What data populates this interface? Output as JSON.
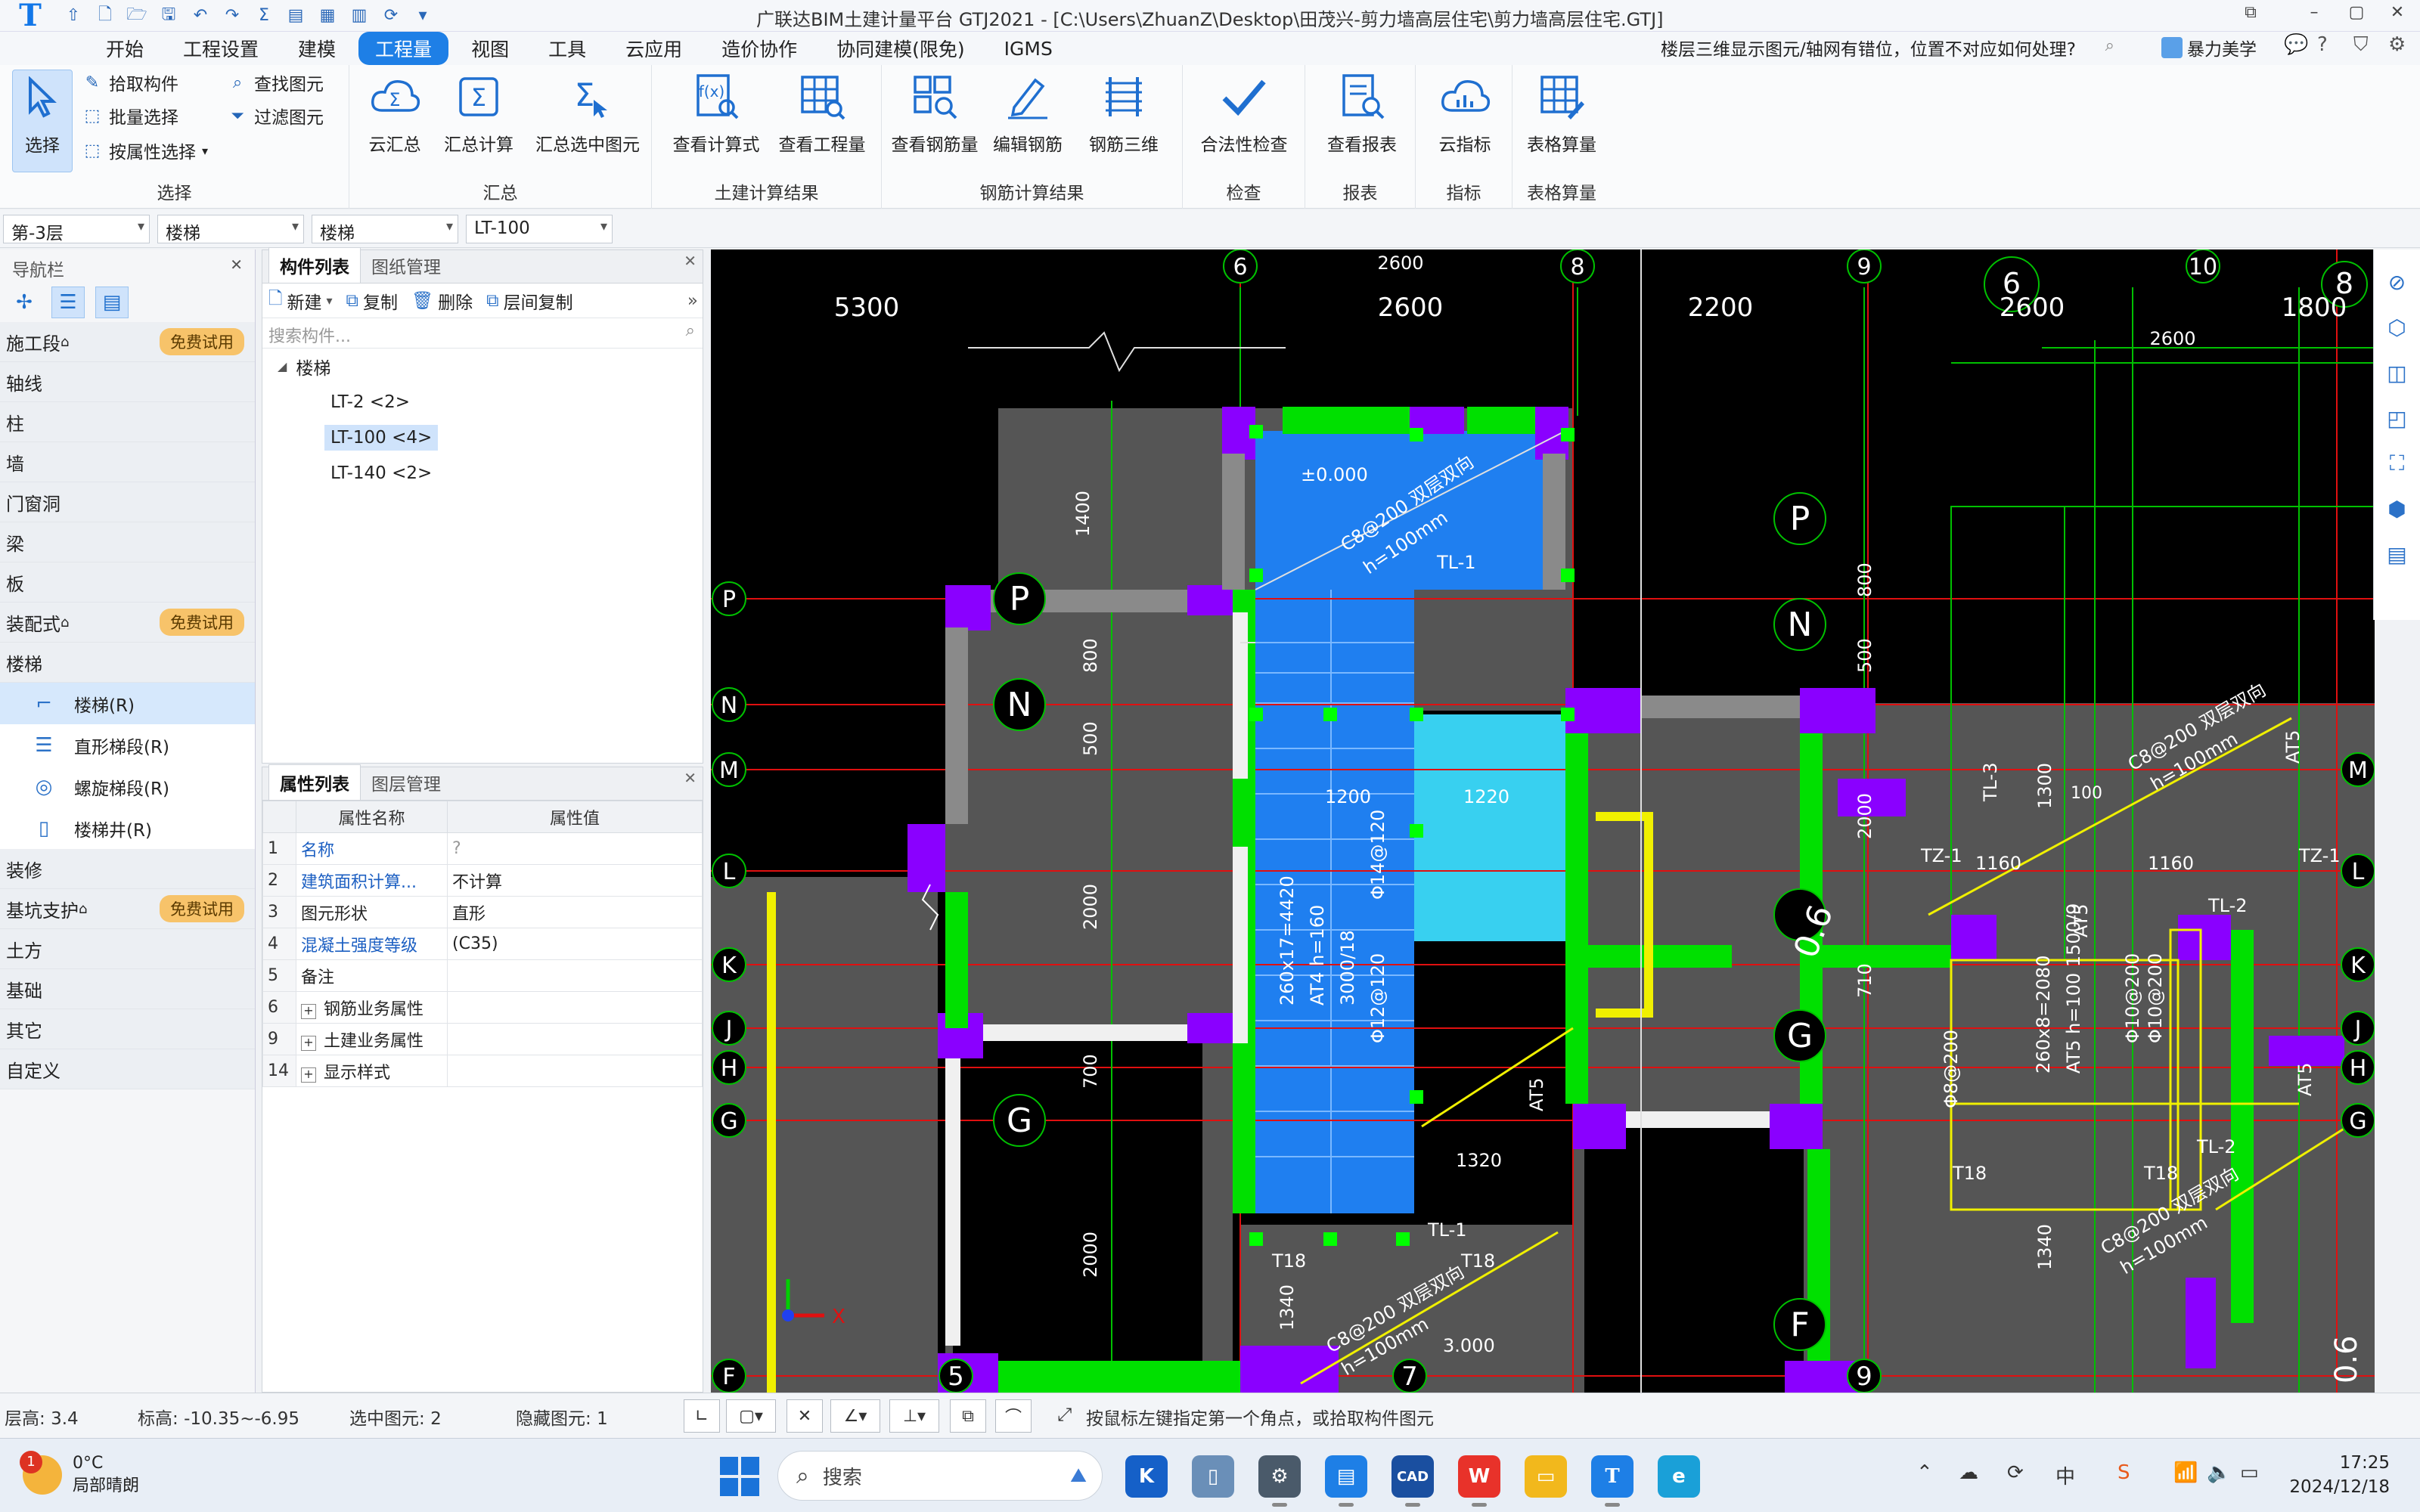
{
  "app": {
    "logo": "T",
    "title": "广联达BIM土建计量平台 GTJ2021 - [C:\\Users\\ZhuanZ\\Desktop\\田茂兴-剪力墙高层住宅\\剪力墙高层住宅.GTJ]"
  },
  "quick_access": [
    "arrow-up-icon",
    "new-file-icon",
    "open-folder-icon",
    "save-icon",
    "undo-icon",
    "redo-icon",
    "sum-icon",
    "chart-icon",
    "grid-icon",
    "stair-icon",
    "refresh-icon",
    "dropdown-icon"
  ],
  "menu": {
    "items": [
      "开始",
      "工程设置",
      "建模",
      "工程量",
      "视图",
      "工具",
      "云应用",
      "造价协作",
      "协同建模(限免)",
      "IGMS"
    ],
    "active_index": 3,
    "help_search": "楼层三维显示图元/轴网有错位，位置不对应如何处理?",
    "user": "暴力美学"
  },
  "ribbon": {
    "select_group": {
      "label": "选择",
      "select_btn": "选择",
      "pick": "拾取构件",
      "batch": "批量选择",
      "by_attr": "按属性选择",
      "find": "查找图元",
      "filter": "过滤图元"
    },
    "summary_group": {
      "label": "汇总",
      "cloud": "云汇总",
      "calc": "汇总计算",
      "calc_sel": "汇总选中图元"
    },
    "civil_group": {
      "label": "土建计算结果",
      "view_formula": "查看计算式",
      "view_quantity": "查看工程量"
    },
    "rebar_group": {
      "label": "钢筋计算结果",
      "view_rebar": "查看钢筋量",
      "edit_rebar": "编辑钢筋",
      "rebar_3d": "钢筋三维"
    },
    "check_group": {
      "label": "检查",
      "legal": "合法性检查"
    },
    "report_group": {
      "label": "报表",
      "view_report": "查看报表"
    },
    "index_group": {
      "label": "指标",
      "cloud_index": "云指标"
    },
    "table_group": {
      "label": "表格算量",
      "table_calc": "表格算量"
    }
  },
  "selectors": {
    "floor": "第-3层",
    "category": "楼梯",
    "subcategory": "楼梯",
    "component": "LT-100"
  },
  "nav": {
    "title": "导航栏",
    "trial_label": "免费试用",
    "categories": [
      {
        "label": "施工段",
        "trial": true,
        "locked": true
      },
      {
        "label": "轴线"
      },
      {
        "label": "柱"
      },
      {
        "label": "墙"
      },
      {
        "label": "门窗洞"
      },
      {
        "label": "梁"
      },
      {
        "label": "板"
      },
      {
        "label": "装配式",
        "trial": true,
        "locked": true
      },
      {
        "label": "楼梯"
      }
    ],
    "stair_items": [
      "楼梯(R)",
      "直形梯段(R)",
      "螺旋梯段(R)",
      "楼梯井(R)"
    ],
    "categories_after": [
      {
        "label": "装修"
      },
      {
        "label": "基坑支护",
        "trial": true,
        "locked": true
      },
      {
        "label": "土方"
      },
      {
        "label": "基础"
      },
      {
        "label": "其它"
      },
      {
        "label": "自定义"
      }
    ]
  },
  "component_panel": {
    "tabs": [
      "构件列表",
      "图纸管理"
    ],
    "tools": [
      "新建",
      "复制",
      "删除",
      "层间复制"
    ],
    "search_placeholder": "搜索构件...",
    "tree_root": "楼梯",
    "items": [
      "LT-2 <2>",
      "LT-100 <4>",
      "LT-140 <2>"
    ],
    "selected_index": 1
  },
  "property_panel": {
    "tabs": [
      "属性列表",
      "图层管理"
    ],
    "header_name": "属性名称",
    "header_value": "属性值",
    "rows": [
      {
        "num": "1",
        "name": "名称",
        "value": "?",
        "blue": true,
        "expand": false
      },
      {
        "num": "2",
        "name": "建筑面积计算...",
        "value": "不计算",
        "blue": true,
        "expand": false
      },
      {
        "num": "3",
        "name": "图元形状",
        "value": "直形",
        "blue": false,
        "expand": false
      },
      {
        "num": "4",
        "name": "混凝土强度等级",
        "value": "(C35)",
        "blue": true,
        "expand": false
      },
      {
        "num": "5",
        "name": "备注",
        "value": "",
        "blue": false,
        "expand": false
      },
      {
        "num": "6",
        "name": "钢筋业务属性",
        "value": "",
        "blue": false,
        "expand": true
      },
      {
        "num": "9",
        "name": "土建业务属性",
        "value": "",
        "blue": false,
        "expand": true
      },
      {
        "num": "14",
        "name": "显示样式",
        "value": "",
        "blue": false,
        "expand": true
      }
    ]
  },
  "drawing": {
    "top_dims": [
      "5300",
      "2600",
      "2200",
      "2600",
      "1800"
    ],
    "top_small_dims": [
      "2600",
      "2600"
    ],
    "axis_top": [
      "6",
      "8",
      "9",
      "6",
      "10",
      "8"
    ],
    "axis_left": [
      "P",
      "N",
      "M",
      "L",
      "K",
      "J",
      "H",
      "G",
      "F"
    ],
    "axis_right": [
      "M",
      "L",
      "K",
      "J",
      "H",
      "G"
    ],
    "axis_bottom": [
      "5",
      "7",
      "9"
    ],
    "room_labels": [
      "P",
      "N",
      "G",
      "G",
      "F",
      "N",
      "P"
    ],
    "texts": {
      "level_top": "±0.000",
      "rebar_note1": "C8@200 双层双向",
      "rebar_note1b": "h=100mm",
      "tl1_top": "TL-1",
      "tl1_bottom": "TL-1",
      "d1200": "1200",
      "d1220": "1220",
      "d1320": "1320",
      "at4": "260x17=4420",
      "at4b": "AT4 h=160",
      "at4c": "3000/18",
      "rebar_a": "Φ14@120",
      "rebar_b": "Φ12@120",
      "at5": "AT5",
      "level_bottom": "3.000",
      "t18a": "T18",
      "t18b": "T18",
      "dim1400": "1400",
      "dim800": "800",
      "dim500": "500",
      "dim2000a": "2000",
      "dim700": "700",
      "dim2000b": "2000",
      "dim1340": "1340",
      "rebar_note2": "C8@200 双层双向",
      "rebar_note2b": "h=100mm",
      "right_800": "800",
      "right_500": "500",
      "right_1300": "1300",
      "right_2000": "2000",
      "right_710": "710",
      "tl2": "TL-2",
      "tl2b": "TL-2",
      "tl3": "TL-3",
      "tz1": "TZ-1",
      "tz1b": "TZ-1",
      "d1160a": "1160",
      "d100": "100",
      "d1160b": "1160",
      "at5r": "AT5",
      "at5r2": "AT5",
      "at5r3": "AT5",
      "right_rebar": "C8@200 双层双向",
      "right_rebar_b": "h=100mm",
      "right_rebar2": "C8@200 双层双向",
      "right_rebar2b": "h=100mm",
      "r260": "260x8=2080",
      "r1500": "AT5 h=100 1500/9",
      "r_phi1": "Φ10@200",
      "r_phi2": "Φ10@200",
      "r_phi3": "Φ8@200",
      "r_t18a": "T18",
      "r_t18b": "T18",
      "r1340": "1340",
      "axis_rot": "0.6",
      "axis_rot2": "0.6"
    }
  },
  "status": {
    "floor_height_label": "层高:",
    "floor_height": "3.4",
    "elev_label": "标高:",
    "elev": "-10.35~-6.95",
    "selected_label": "选中图元:",
    "selected": "2",
    "hidden_label": "隐藏图元:",
    "hidden": "1",
    "hint": "按鼠标左键指定第一个角点，或拾取构件图元"
  },
  "taskbar": {
    "weather_temp": "0°C",
    "weather_desc": "局部晴朗",
    "weather_badge": "1",
    "search": "搜索",
    "time": "17:25",
    "date": "2024/12/18"
  },
  "colors": {
    "accent": "#1e7fe6",
    "wall_purple": "#8a00ff",
    "wall_green": "#00e000",
    "slab_blue": "#1f7ff0",
    "slab_cyan": "#38d0f0",
    "grid_red": "#e01010",
    "yellow": "#f0f000",
    "grey_fill": "#555555"
  }
}
